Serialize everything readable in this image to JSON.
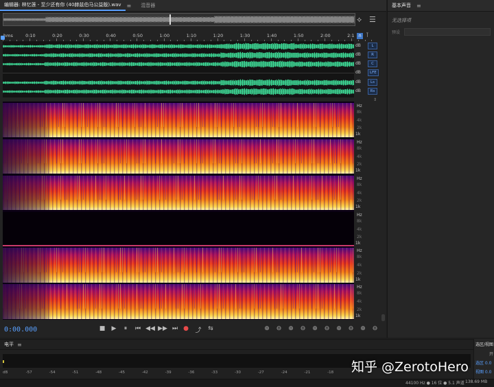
{
  "editor": {
    "tab_active": "编辑器: 林忆莲 - 至少还有你 (40赫兹伯马公益版).wav",
    "tab_menu": "≡",
    "tab_mixer": "混音器"
  },
  "right_panel": {
    "title": "基本声音",
    "menu": "≡",
    "subtitle": "无选择项",
    "preset_label": "预设"
  },
  "ruler": {
    "labels": [
      "hms",
      "0:10",
      "0:20",
      "0:30",
      "0:40",
      "0:50",
      "1:00",
      "1:10",
      "1:20",
      "1:30",
      "1:40",
      "1:50",
      "2:00",
      "2:1"
    ]
  },
  "channels": [
    {
      "db": "dB",
      "button": "L"
    },
    {
      "db": "dB",
      "button": "R"
    },
    {
      "db": "dB",
      "button": "C"
    },
    {
      "db": "dB",
      "button": "LFE"
    },
    {
      "db": "dB",
      "button": "Ls"
    },
    {
      "db": "dB",
      "button": "Rs"
    }
  ],
  "spectral_bands": [
    {
      "labels": [
        "Hz",
        "8k",
        "4k",
        "2k",
        "1k"
      ]
    },
    {
      "labels": [
        "Hz",
        "8k",
        "4k",
        "2k",
        "1k"
      ]
    },
    {
      "labels": [
        "Hz",
        "8k",
        "4k",
        "2k",
        "1k"
      ]
    },
    {
      "labels": [
        "Hz",
        "8k",
        "4k",
        "2k",
        "1k"
      ]
    },
    {
      "labels": [
        "Hz",
        "8k",
        "4k",
        "2k",
        "1k"
      ]
    },
    {
      "labels": [
        "Hz",
        "8k",
        "4k",
        "2k",
        "1k"
      ]
    }
  ],
  "transport": {
    "timecode": "0:00.000",
    "buttons": [
      "■",
      "▶",
      "⏸",
      "⏮",
      "◀◀",
      "▶▶",
      "⏭",
      "●",
      "⤴",
      "⇆"
    ]
  },
  "zoom_tools": [
    "⊕",
    "⊖",
    "⊕",
    "⊖",
    "⊕",
    "⊖",
    "⊕",
    "⊖",
    "⊕",
    "⊖"
  ],
  "level": {
    "title": "电平",
    "menu": "≡",
    "scale": [
      "dB",
      "-57",
      "-54",
      "-51",
      "-48",
      "-45",
      "-42",
      "-39",
      "-36",
      "-33",
      "-30",
      "-27",
      "-24",
      "-21",
      "-18"
    ]
  },
  "selection_view": {
    "title": "选区/视图",
    "rows": [
      "开",
      "选区 0.0",
      "视图 0.0"
    ]
  },
  "statusbar": {
    "format": "44100 Hz ● 16 位 ● 5.1 声道",
    "size": "138.69 MB"
  },
  "watermark": "知乎 @ZerotoHero",
  "colors": {
    "accent": "#5aa0ff",
    "waveform": "#3ddc97",
    "record": "#e84a4a"
  }
}
